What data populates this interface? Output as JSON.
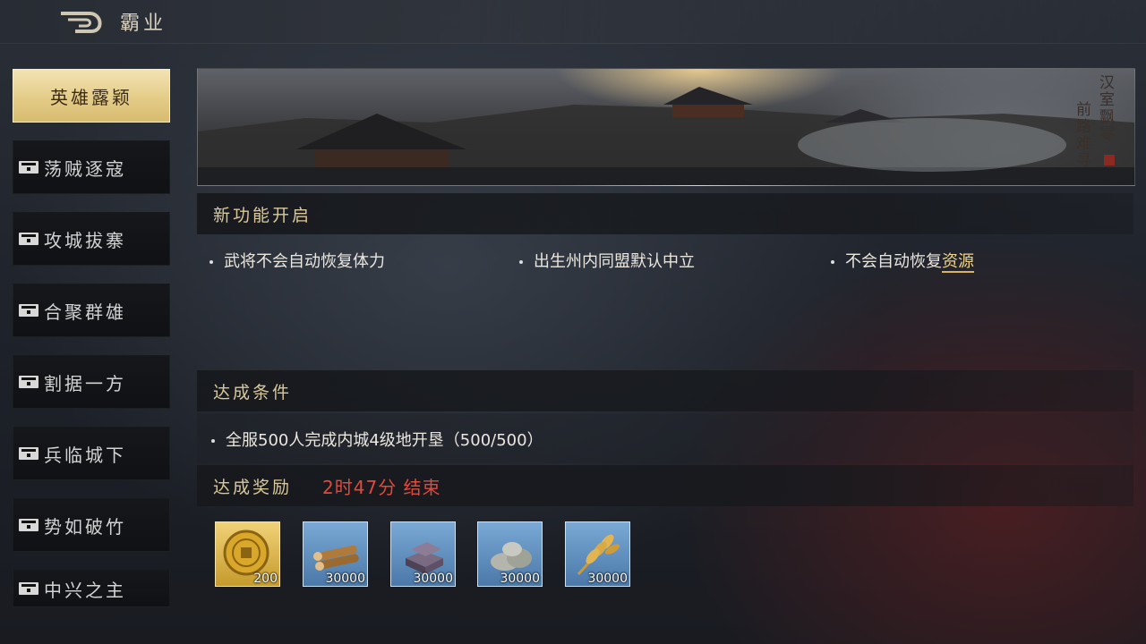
{
  "header": {
    "title": "霸业",
    "back_icon": "back-arrow-icon"
  },
  "nav": {
    "items": [
      {
        "label": "英雄露颖",
        "active": true,
        "locked": false
      },
      {
        "label": "荡贼逐寇",
        "active": false,
        "locked": true
      },
      {
        "label": "攻城拔寨",
        "active": false,
        "locked": true
      },
      {
        "label": "合聚群雄",
        "active": false,
        "locked": true
      },
      {
        "label": "割据一方",
        "active": false,
        "locked": true
      },
      {
        "label": "兵临城下",
        "active": false,
        "locked": true
      },
      {
        "label": "势如破竹",
        "active": false,
        "locked": true
      },
      {
        "label": "中兴之主",
        "active": false,
        "locked": true
      }
    ]
  },
  "banner": {
    "line1": "汉室飘零",
    "line2": "前路难寻"
  },
  "new_features": {
    "title": "新功能开启",
    "items": [
      {
        "text": "武将不会自动恢复体力"
      },
      {
        "text": "出生州内同盟默认中立"
      },
      {
        "text": "不会自动恢复",
        "link": "资源"
      }
    ]
  },
  "conditions": {
    "title": "达成条件",
    "items": [
      {
        "text": "全服500人完成内城4级地开垦（500/500）"
      }
    ]
  },
  "rewards": {
    "title": "达成奖励",
    "timer": "2时47分 结束",
    "items": [
      {
        "icon": "gold-coin-icon",
        "qty": "200"
      },
      {
        "icon": "wood-icon",
        "qty": "30000"
      },
      {
        "icon": "iron-icon",
        "qty": "30000"
      },
      {
        "icon": "stone-icon",
        "qty": "30000"
      },
      {
        "icon": "grain-icon",
        "qty": "30000"
      }
    ]
  },
  "colors": {
    "accent_gold": "#e4cc88",
    "timer_red": "#e04a3e",
    "section_title": "#d9c89c"
  }
}
